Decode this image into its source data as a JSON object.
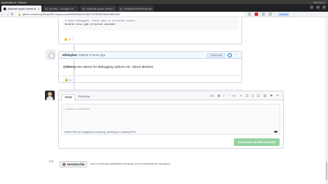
{
  "os": {
    "menu_label": "Applications",
    "places_label": "Places",
    "clock": "Tue 11:17"
  },
  "browser": {
    "tabs": [
      {
        "title": "Akismet spam check for lo",
        "active": true
      },
      {
        "title": "[Order] - Google Dri"
      },
      {
        "title": "Akismet spam check f"
      },
      {
        "title": "SimpleScreenRecorder"
      }
    ],
    "url": "github.com/denny/ShinyCMS-ruby/commit/9f93bf36a1f47d8b722f7f534015b4b1f6874f2b",
    "profile_label": "Paused"
  },
  "code_block": {
    "comment_line": "# Once debugged, reset gem to pristine state:",
    "command_line": "bundle exec gem pristine akismet"
  },
  "reactions": {
    "first": {
      "emoji": "thumbs-up",
      "count": "1"
    },
    "second": {
      "emoji": "thumbs-up",
      "count": "1"
    }
  },
  "comment": {
    "author": "eliotsykes",
    "meta": "replied 3 hours ago",
    "role_badge": "Collaborator",
    "more": "···",
    "mention": "@denny",
    "body": " see above for debugging options etc. about akismet"
  },
  "new_comment": {
    "tab_write": "Write",
    "tab_preview": "Preview",
    "toolbar": [
      "AA",
      "B",
      "I",
      "“",
      "<>",
      "↗",
      "☰",
      "≡",
      "☑",
      "@",
      "⚑",
      "↶"
    ],
    "placeholder": "Leave a comment",
    "attach_text": "Attach files by dragging & dropping, selecting or pasting them.",
    "submit_label": "Comment on this commit"
  },
  "notifications": {
    "icon_label": "((•))",
    "unsubscribe_label": "Unsubscribe",
    "reason": "You’re receiving notifications because you’re watching this repository."
  }
}
